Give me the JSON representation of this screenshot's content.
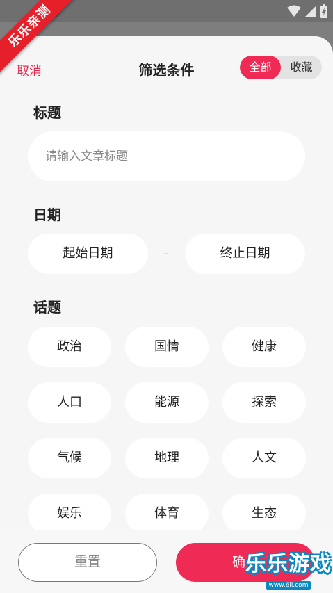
{
  "watermark": {
    "ribbon_text": "乐乐亲测",
    "brand_text": "乐乐游戏",
    "brand_url": "www.6ll.com"
  },
  "header": {
    "cancel_label": "取消",
    "title": "筛选条件",
    "segments": [
      "全部",
      "收藏"
    ],
    "active_segment": "全部"
  },
  "sections": {
    "title_label": "标题",
    "title_placeholder": "请输入文章标题",
    "date_label": "日期",
    "date_start": "起始日期",
    "date_end": "终止日期",
    "topic_label": "话题"
  },
  "topics": [
    "政治",
    "国情",
    "健康",
    "人口",
    "能源",
    "探索",
    "气候",
    "地理",
    "人文",
    "娱乐",
    "体育",
    "生态"
  ],
  "footer": {
    "reset_label": "重置",
    "confirm_label": "确认"
  },
  "colors": {
    "accent": "#ee2a55",
    "sheet_bg": "#f6f6f6",
    "pill_bg": "#ffffff"
  }
}
